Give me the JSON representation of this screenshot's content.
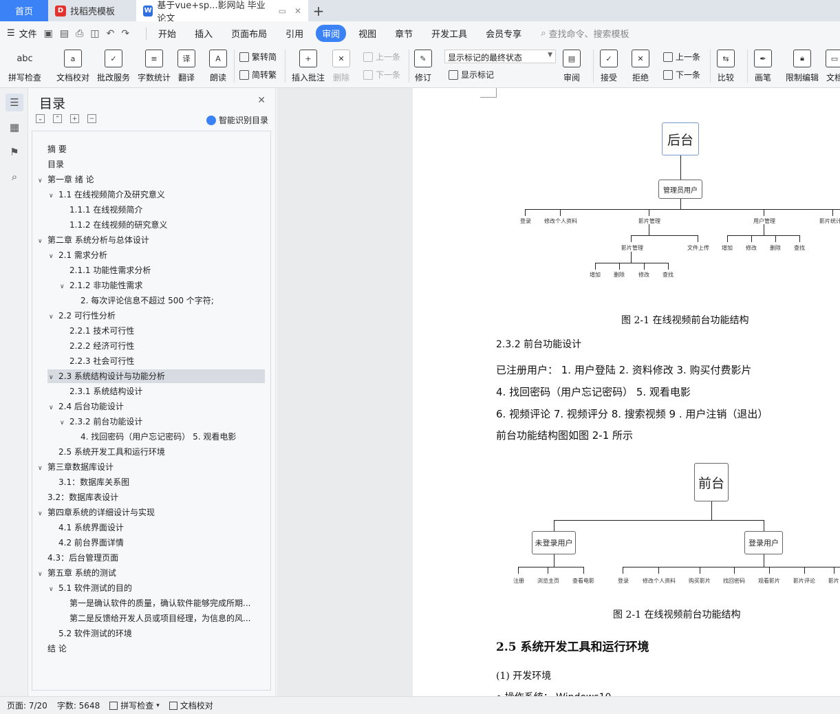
{
  "tabs": [
    {
      "label": "首页"
    },
    {
      "label": "找稻壳模板"
    },
    {
      "label": "基于vue+sp...影网站 毕业论文"
    }
  ],
  "menu": {
    "file": "文件",
    "items": [
      "开始",
      "插入",
      "页面布局",
      "引用",
      "审阅",
      "视图",
      "章节",
      "开发工具",
      "会员专享"
    ],
    "active": "审阅",
    "search": "查找命令、搜索模板"
  },
  "ribbon": {
    "spell": "拼写检查",
    "proof": "文档校对",
    "batch": "批改服务",
    "wordcount": "字数统计",
    "translate": "翻译",
    "read": "朗读",
    "t2s": "繁转简",
    "s2t": "简转繁",
    "comment": "插入批注",
    "delete": "删除",
    "prev": "上一条",
    "next": "下一条",
    "revise": "修订",
    "markup_state": "显示标记的最终状态",
    "show_markup": "显示标记",
    "review": "审阅",
    "accept": "接受",
    "reject": "拒绝",
    "prev2": "上一条",
    "next2": "下一条",
    "compare": "比较",
    "pen": "画笔",
    "restrict": "限制编辑",
    "doc": "文档"
  },
  "toc": {
    "title": "目录",
    "smart": "智能识别目录",
    "items": [
      {
        "text": "摘  要",
        "level": 0,
        "car": ""
      },
      {
        "text": "目录",
        "level": 0,
        "car": ""
      },
      {
        "text": "第一章  绪  论",
        "level": 0,
        "car": "v"
      },
      {
        "text": "1.1  在线视频简介及研究意义",
        "level": 1,
        "car": "v"
      },
      {
        "text": "1.1.1  在线视频简介",
        "level": 2,
        "car": ""
      },
      {
        "text": "1.1.2  在线视频的研究意义",
        "level": 2,
        "car": ""
      },
      {
        "text": "第二章  系统分析与总体设计",
        "level": 0,
        "car": "v"
      },
      {
        "text": "2.1  需求分析",
        "level": 1,
        "car": "v"
      },
      {
        "text": "2.1.1  功能性需求分析",
        "level": 2,
        "car": ""
      },
      {
        "text": "2.1.2  非功能性需求",
        "level": 2,
        "car": "v"
      },
      {
        "text": "2.  每次评论信息不超过  500  个字符;",
        "level": 3,
        "car": ""
      },
      {
        "text": "2.2  可行性分析",
        "level": 1,
        "car": "v"
      },
      {
        "text": "2.2.1  技术可行性",
        "level": 2,
        "car": ""
      },
      {
        "text": "2.2.2  经济可行性",
        "level": 2,
        "car": ""
      },
      {
        "text": "2.2.3  社会可行性",
        "level": 2,
        "car": ""
      },
      {
        "text": "2.3  系统结构设计与功能分析",
        "level": 1,
        "car": "v",
        "selected": true
      },
      {
        "text": "2.3.1  系统结构设计",
        "level": 2,
        "car": ""
      },
      {
        "text": "2.4  后台功能设计",
        "level": 1,
        "car": "v"
      },
      {
        "text": "2.3.2  前台功能设计",
        "level": 2,
        "car": "v"
      },
      {
        "text": "4.  找回密码（用户忘记密码）   5.  观看电影",
        "level": 3,
        "car": ""
      },
      {
        "text": "2.5  系统开发工具和运行环境",
        "level": 1,
        "car": ""
      },
      {
        "text": "第三章数据库设计",
        "level": 0,
        "car": "v"
      },
      {
        "text": "3.1：数据库关系图",
        "level": 1,
        "car": ""
      },
      {
        "text": "3.2：数据库表设计",
        "level": 0,
        "car": ""
      },
      {
        "text": "第四章系统的详细设计与实现",
        "level": 0,
        "car": "v"
      },
      {
        "text": "4.1  系统界面设计",
        "level": 1,
        "car": ""
      },
      {
        "text": "4.2  前台界面详情",
        "level": 1,
        "car": ""
      },
      {
        "text": "4.3：后台管理页面",
        "level": 0,
        "car": ""
      },
      {
        "text": "第五章  系统的测试",
        "level": 0,
        "car": "v"
      },
      {
        "text": "5.1  软件测试的目的",
        "level": 1,
        "car": "v"
      },
      {
        "text": "第一是确认软件的质量，确认软件能够完成所期...",
        "level": 2,
        "car": ""
      },
      {
        "text": "第二是反馈给开发人员或项目经理，为信息的风...",
        "level": 2,
        "car": ""
      },
      {
        "text": "5.2  软件测试的环境",
        "level": 1,
        "car": ""
      },
      {
        "text": "结  论",
        "level": 0,
        "car": ""
      }
    ]
  },
  "doc": {
    "diagram1": {
      "root": "后台",
      "admin": "管理员用户",
      "l1": [
        "登录",
        "修改个人资料",
        "影片管理",
        "用户管理",
        "影片统计"
      ],
      "film_sub": [
        "影片管理",
        "文件上传"
      ],
      "user_sub": [
        "增加",
        "修改",
        "删除",
        "查找"
      ],
      "film_ops": [
        "增加",
        "删除",
        "修改",
        "查找"
      ]
    },
    "cap1": "图  2-1  在线视频前台功能结构",
    "h232": "2.3.2  前台功能设计",
    "p1": "已注册用户：  1. 用户登陆  2. 资料修改  3. 购买付费影片",
    "p2": "4. 找回密码（用户忘记密码）   5. 观看电影",
    "p3": "6. 视频评论  7. 视频评分  8. 搜索视频  9 . 用户注销（退出）",
    "p4": "前台功能结构图如图  2-1  所示",
    "diagram2": {
      "root": "前台",
      "guest": "未登录用户",
      "logged": "登录用户",
      "guest_ops": [
        "注册",
        "浏览主页",
        "查看电影"
      ],
      "user_ops": [
        "登录",
        "修改个人资料",
        "购买影片",
        "找回密码",
        "观看影片",
        "影片评论",
        "影片"
      ]
    },
    "cap2": "图  2-1  在线视频前台功能结构",
    "h25": "2.5  系统开发工具和运行环境",
    "env": "(1) 开发环境",
    "os": "• 操作系统：  Windows10"
  },
  "status": {
    "page": "页面: 7/20",
    "words": "字数: 5648",
    "spell": "拼写检查",
    "proof": "文档校对"
  }
}
